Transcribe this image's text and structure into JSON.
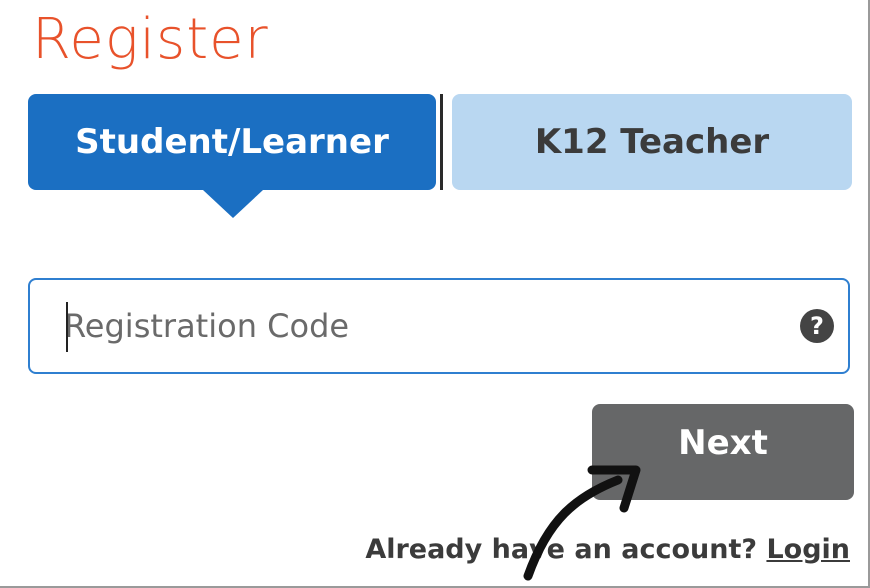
{
  "page": {
    "title": "Register",
    "accent_color": "#e8522b"
  },
  "tabs": [
    {
      "label": "Student/Learner",
      "selected": true,
      "color": "#1b6fc2"
    },
    {
      "label": "K12 Teacher",
      "selected": false,
      "color": "#b9d7f1"
    }
  ],
  "registration": {
    "placeholder": "Registration Code",
    "value": "",
    "help_icon": "question-circle-icon",
    "help_glyph": "?"
  },
  "actions": {
    "next_label": "Next",
    "next_color": "#666768"
  },
  "footer": {
    "prompt": "Already have an account? ",
    "login_label": "Login"
  },
  "annotation": {
    "icon": "curved-arrow-icon"
  }
}
